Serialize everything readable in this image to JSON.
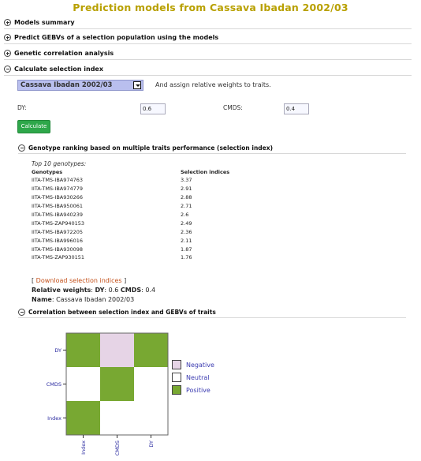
{
  "page_title": "Prediction models from Cassava Ibadan 2002/03",
  "sections": {
    "models_summary": "Models summary",
    "predict_gebvs": "Predict GEBVs of a selection population using the models",
    "genetic_correlation": "Genetic correlation analysis",
    "selection_index": "Calculate selection index"
  },
  "selection": {
    "population": "Cassava Ibadan 2002/03",
    "assign_text": "And assign relative weights to traits.",
    "traits": [
      {
        "label": "DY:",
        "value": "0.6"
      },
      {
        "label": "CMDS:",
        "value": "0.4"
      }
    ],
    "calculate_label": "Calculate"
  },
  "ranking": {
    "heading": "Genotype ranking based on multiple traits performance (selection index)",
    "top_label": "Top 10 genotypes:",
    "col_genotypes": "Genotypes",
    "col_indices": "Selection indices",
    "rows": [
      {
        "g": "IITA-TMS-IBA974763",
        "v": "3.37"
      },
      {
        "g": "IITA-TMS-IBA974779",
        "v": "2.91"
      },
      {
        "g": "IITA-TMS-IBA930266",
        "v": "2.88"
      },
      {
        "g": "IITA-TMS-IBA950061",
        "v": "2.71"
      },
      {
        "g": "IITA-TMS-IBA940239",
        "v": "2.6"
      },
      {
        "g": "IITA-TMS-ZAP940153",
        "v": "2.49"
      },
      {
        "g": "IITA-TMS-IBA972205",
        "v": "2.36"
      },
      {
        "g": "IITA-TMS-IBA996016",
        "v": "2.11"
      },
      {
        "g": "IITA-TMS-IBA930098",
        "v": "1.87"
      },
      {
        "g": "IITA-TMS-ZAP930151",
        "v": "1.76"
      }
    ],
    "download_prefix": "[ ",
    "download_link": "Download selection indices",
    "download_suffix": " ]",
    "weights_label": "Relative weights",
    "weights_sep": ": ",
    "weight_dy_label": "DY",
    "weight_dy_value": ": 0.6 ",
    "weight_cmds_label": "CMDS",
    "weight_cmds_value": ": 0.4",
    "name_label": "Name",
    "name_value": ": Cassava Ibadan 2002/03"
  },
  "correlation": {
    "heading": "Correlation between selection index and GEBVs of traits"
  },
  "chart_data": {
    "type": "heatmap",
    "x_labels": [
      "Index",
      "CMDS",
      "DY"
    ],
    "y_labels": [
      "DY",
      "CMDS",
      "Index"
    ],
    "cells": [
      [
        "Positive",
        "Negative",
        "Positive"
      ],
      [
        "Neutral",
        "Positive",
        "Neutral"
      ],
      [
        "Positive",
        "Neutral",
        "Neutral"
      ]
    ],
    "legend": [
      {
        "label": "Negative",
        "color": "#e6d4e6"
      },
      {
        "label": "Neutral",
        "color": "#ffffff"
      },
      {
        "label": "Positive",
        "color": "#78a832"
      }
    ]
  }
}
